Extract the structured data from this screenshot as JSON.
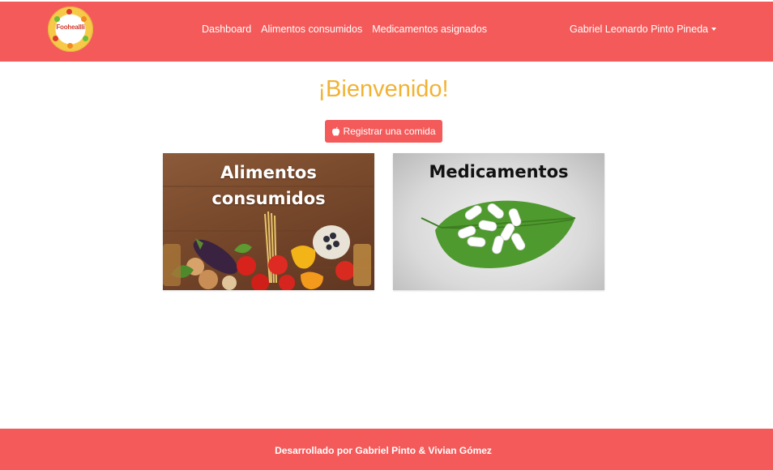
{
  "brand": {
    "logo_text": "Fooheallli",
    "colors": {
      "primary": "#f45a5a",
      "accent": "#f2b233"
    }
  },
  "nav": {
    "items": [
      {
        "label": "Dashboard"
      },
      {
        "label": "Alimentos consumidos"
      },
      {
        "label": "Medicamentos asignados"
      }
    ],
    "user_name": "Gabriel Leonardo Pinto Pineda"
  },
  "main": {
    "welcome": "¡Bienvenido!",
    "register_button": "Registrar una comida",
    "register_icon": "apple-icon",
    "cards": [
      {
        "title_line1": "Alimentos",
        "title_line2": "consumidos"
      },
      {
        "title": "Medicamentos"
      }
    ]
  },
  "footer": {
    "text": "Desarrollado por Gabriel Pinto & Vivian Gómez"
  }
}
